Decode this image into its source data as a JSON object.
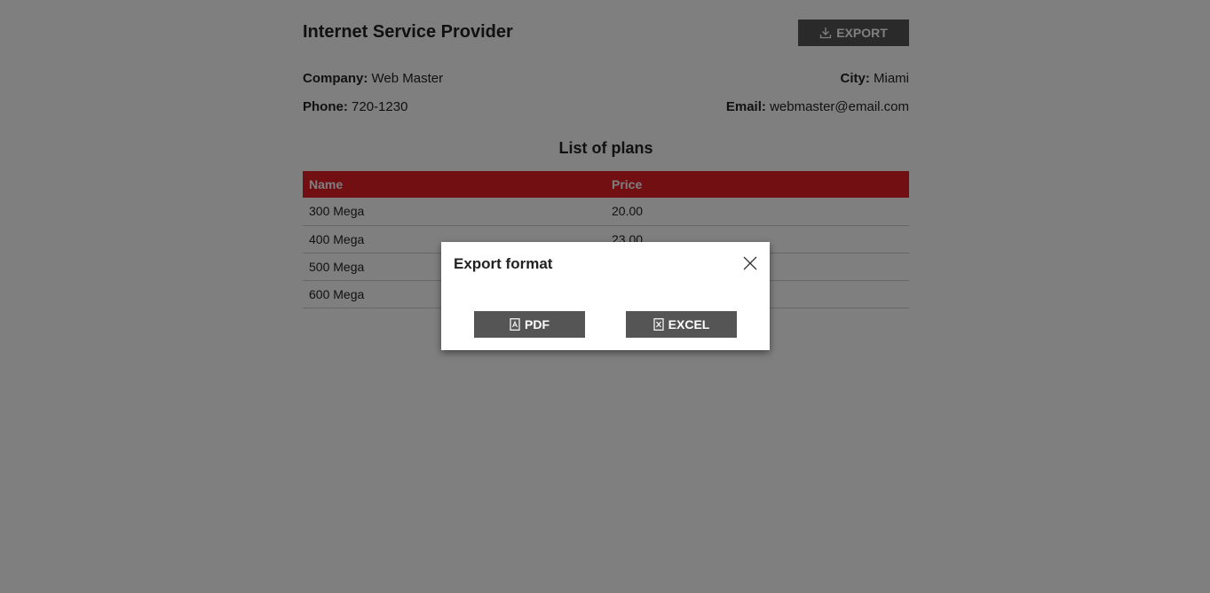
{
  "header": {
    "title": "Internet Service Provider",
    "export_label": "EXPORT"
  },
  "info": {
    "company_label": "Company:",
    "company_value": "Web Master",
    "city_label": "City:",
    "city_value": "Miami",
    "phone_label": "Phone:",
    "phone_value": "720-1230",
    "email_label": "Email:",
    "email_value": "webmaster@email.com"
  },
  "plans": {
    "title": "List of plans",
    "columns": [
      "Name",
      "Price"
    ],
    "rows": [
      {
        "name": "300 Mega",
        "price": "20.00"
      },
      {
        "name": "400 Mega",
        "price": "23.00"
      },
      {
        "name": "500 Mega",
        "price": ""
      },
      {
        "name": "600 Mega",
        "price": ""
      }
    ]
  },
  "modal": {
    "title": "Export format",
    "pdf_label": "PDF",
    "excel_label": "EXCEL"
  },
  "icons": {
    "export": "download-icon",
    "close": "close-icon",
    "pdf": "pdf-file-icon",
    "excel": "excel-file-icon"
  },
  "colors": {
    "table_header": "#e31e24",
    "button": "#555555",
    "overlay": "rgba(0,0,0,0.5)"
  }
}
